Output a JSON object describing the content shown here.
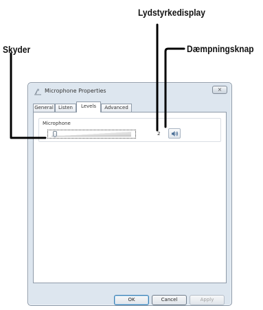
{
  "callouts": {
    "volume_display": "Lydstyrkedisplay",
    "mute_button": "Dæmpningsknap",
    "slider": "Skyder"
  },
  "dialog": {
    "title": "Microphone Properties",
    "close_glyph": "×",
    "tabs": [
      "General",
      "Listen",
      "Levels",
      "Advanced"
    ],
    "active_tab": "Levels",
    "microphone_group": {
      "label": "Microphone",
      "slider_level": 0.02,
      "volume_value": "2"
    },
    "buttons": {
      "ok": "OK",
      "cancel": "Cancel",
      "apply": "Apply"
    }
  },
  "colors": {
    "dialog_frame": "#dde6ef",
    "leader_line": "#000000"
  },
  "icons": {
    "title": "microphone-icon",
    "mute": "speaker-icon"
  }
}
